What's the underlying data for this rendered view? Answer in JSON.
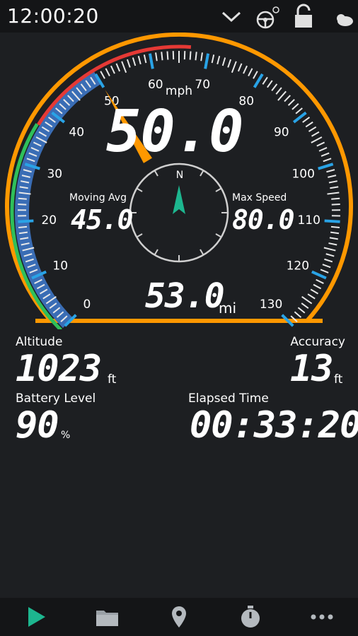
{
  "status_bar": {
    "time": "12:00:20",
    "icons": [
      "chevron-down-icon",
      "steering-wheel-icon",
      "lock-icon",
      "weather-icon"
    ]
  },
  "gauge": {
    "unit": "mph",
    "scale_labels": [
      "0",
      "10",
      "20",
      "30",
      "40",
      "50",
      "60",
      "70",
      "80",
      "90",
      "100",
      "110",
      "120",
      "130"
    ],
    "scale_min": 0,
    "scale_max": 130,
    "current_speed": "50.0",
    "needle_value": 50,
    "moving_avg_label": "Moving Avg",
    "moving_avg_value": "45.0",
    "max_speed_label": "Max Speed",
    "max_speed_value": "80.0",
    "distance_value": "53.0",
    "distance_unit": "mi",
    "compass_label": "N",
    "colors": {
      "ring": "#ff9800",
      "blue_band": "#3a6db5",
      "green_band": "#2fbf5a",
      "red_band": "#e53935",
      "accent": "#1db68f"
    }
  },
  "stats": {
    "altitude_label": "Altitude",
    "altitude_value": "1023",
    "altitude_unit": "ft",
    "accuracy_label": "Accuracy",
    "accuracy_value": "13",
    "accuracy_unit": "ft",
    "battery_label": "Battery Level",
    "battery_value": "90",
    "battery_unit": "%",
    "elapsed_label": "Elapsed Time",
    "elapsed_value": "00:33:20"
  },
  "bottom_nav": {
    "items": [
      "play-icon",
      "folder-icon",
      "location-pin-icon",
      "stopwatch-icon",
      "more-icon"
    ]
  }
}
